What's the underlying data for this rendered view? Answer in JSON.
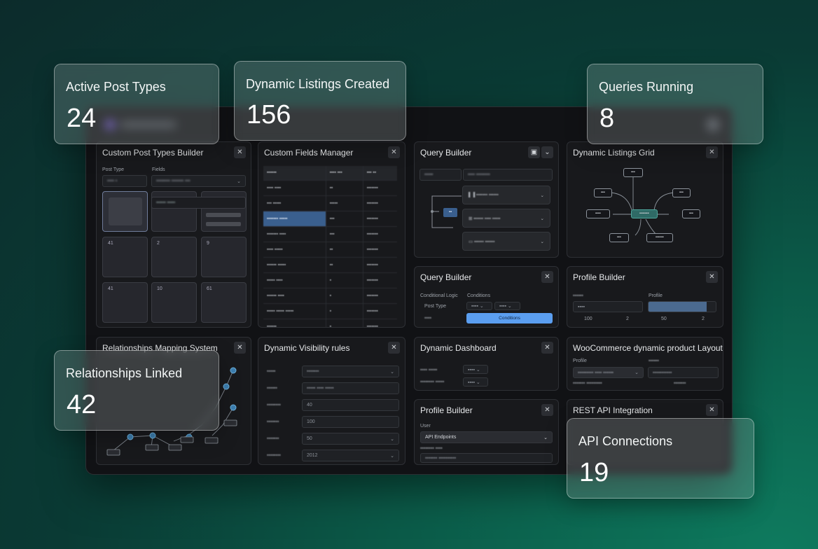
{
  "stats": {
    "active_post_types": {
      "label": "Active Post Types",
      "value": "24"
    },
    "dynamic_listings": {
      "label": "Dynamic Listings Created",
      "value": "156"
    },
    "queries_running": {
      "label": "Queries Running",
      "value": "8"
    },
    "relationships_linked": {
      "label": "Relationships Linked",
      "value": "42"
    },
    "api_connections": {
      "label": "API Connections",
      "value": "19"
    }
  },
  "panels": {
    "cpt_builder": {
      "title": "Custom Post Types Builder",
      "post_type_label": "Post Type",
      "fields_label": "Fields",
      "tiles": [
        "41",
        "2",
        "9",
        "41",
        "10",
        "61"
      ]
    },
    "fields_manager": {
      "title": "Custom Fields Manager"
    },
    "query_builder_1": {
      "title": "Query Builder"
    },
    "listings_grid": {
      "title": "Dynamic Listings Grid"
    },
    "query_builder_2": {
      "title": "Query Builder",
      "conditional_logic": "Conditional Logic",
      "conditions": "Conditions",
      "post_type": "Post Type",
      "button": "Conditions"
    },
    "profile_builder_1": {
      "title": "Profile Builder",
      "profile": "Profile",
      "values": [
        "100",
        "2",
        "50",
        "2"
      ]
    },
    "relationships": {
      "title": "Relationships Mapping System"
    },
    "visibility": {
      "title": "Dynamic Visibility rules",
      "values": [
        "40",
        "100",
        "50",
        "2012"
      ]
    },
    "dashboard": {
      "title": "Dynamic Dashboard"
    },
    "woo_layout": {
      "title": "WooCommerce dynamic product Layout",
      "field_a": "Profile"
    },
    "profile_builder_2": {
      "title": "Profile Builder",
      "user_label": "User",
      "field_value": "API Endpoints"
    },
    "rest_api": {
      "title": "REST API Integration"
    }
  },
  "icons": {
    "close": "close-icon",
    "chevron": "chevron-down-icon"
  }
}
